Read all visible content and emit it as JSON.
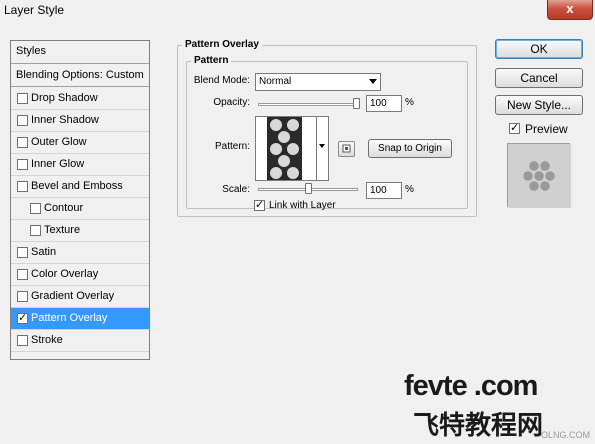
{
  "window": {
    "title": "Layer Style",
    "close_glyph": "x"
  },
  "styles_panel": {
    "header": "Styles",
    "blending_options": "Blending Options: Custom",
    "items": [
      {
        "label": "Drop Shadow",
        "checked": false,
        "sub": false
      },
      {
        "label": "Inner Shadow",
        "checked": false,
        "sub": false
      },
      {
        "label": "Outer Glow",
        "checked": false,
        "sub": false
      },
      {
        "label": "Inner Glow",
        "checked": false,
        "sub": false
      },
      {
        "label": "Bevel and Emboss",
        "checked": false,
        "sub": false
      },
      {
        "label": "Contour",
        "checked": false,
        "sub": true
      },
      {
        "label": "Texture",
        "checked": false,
        "sub": true
      },
      {
        "label": "Satin",
        "checked": false,
        "sub": false
      },
      {
        "label": "Color Overlay",
        "checked": false,
        "sub": false
      },
      {
        "label": "Gradient Overlay",
        "checked": false,
        "sub": false
      },
      {
        "label": "Pattern Overlay",
        "checked": true,
        "sub": false,
        "selected": true
      },
      {
        "label": "Stroke",
        "checked": false,
        "sub": false
      }
    ]
  },
  "pattern_overlay": {
    "group_title": "Pattern Overlay",
    "subgroup_title": "Pattern",
    "blend_mode_label": "Blend Mode:",
    "blend_mode_value": "Normal",
    "opacity_label": "Opacity:",
    "opacity_value": "100",
    "opacity_unit": "%",
    "opacity_percent": 100,
    "pattern_label": "Pattern:",
    "snap_to_origin": "Snap to Origin",
    "scale_label": "Scale:",
    "scale_value": "100",
    "scale_unit": "%",
    "scale_percent": 100,
    "link_with_layer": "Link with Layer",
    "link_checked": true
  },
  "buttons": {
    "ok": "OK",
    "cancel": "Cancel",
    "new_style": "New Style..."
  },
  "preview": {
    "label": "Preview",
    "checked": true
  },
  "watermark": {
    "en": "fevte .com",
    "cn": "飞特教程网",
    "small": "OLNG.COM"
  },
  "colors": {
    "selection": "#3399ff",
    "dialog_bg": "#f0f0f0",
    "close_button": "#c9513f"
  }
}
